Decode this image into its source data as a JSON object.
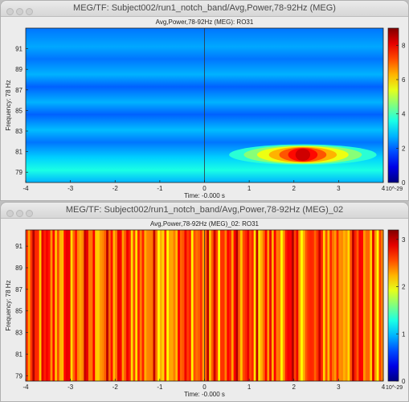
{
  "windows": [
    {
      "title": "MEG/TF: Subject002/run1_notch_band/Avg,Power,78-92Hz (MEG)"
    },
    {
      "title": "MEG/TF: Subject002/run1_notch_band/Avg,Power,78-92Hz (MEG)_02"
    }
  ],
  "chart_data": [
    {
      "type": "heatmap",
      "title": "Avg,Power,78-92Hz (MEG): RO31",
      "xlabel": "Time: -0.000 s",
      "ylabel": "Frequency: 78 Hz",
      "xlim": [
        -4,
        4
      ],
      "ylim": [
        78,
        93
      ],
      "xticks": [
        "-4",
        "-3",
        "-2",
        "-1",
        "0",
        "1",
        "2",
        "3",
        "4"
      ],
      "yticks": [
        "79",
        "81",
        "83",
        "85",
        "87",
        "89",
        "91"
      ],
      "colorbar": {
        "min": 0,
        "max": 9,
        "ticks": [
          "0",
          "2",
          "4",
          "6",
          "8"
        ],
        "exponent": "10^-29",
        "colormap": "jet"
      },
      "cursor_time": 0,
      "background_level": 0.3,
      "hotspot": {
        "time_center": 2.2,
        "freq_center": 80.7,
        "peak_value": 8.3,
        "time_span": [
          0.6,
          3.9
        ],
        "freq_span": [
          79.7,
          81.7
        ]
      }
    },
    {
      "type": "heatmap",
      "title": "Avg,Power,78-92Hz (MEG)_02: RO31",
      "xlabel": "Time: -0.000 s",
      "ylabel": "Frequency: 78 Hz",
      "xlim": [
        -4,
        4
      ],
      "ylim": [
        78.5,
        92.5
      ],
      "xticks": [
        "-4",
        "-3",
        "-2",
        "-1",
        "0",
        "1",
        "2",
        "3",
        "4"
      ],
      "yticks": [
        "79",
        "81",
        "83",
        "85",
        "87",
        "89",
        "91"
      ],
      "colorbar": {
        "min": 0,
        "max": 3.2,
        "ticks": [
          "0",
          "1",
          "2",
          "3"
        ],
        "exponent": "10^-29",
        "colormap": "jet"
      },
      "cursor_time": 0,
      "value_range": [
        2.0,
        3.0
      ],
      "columns": 160,
      "pattern": "vertical stripes, constant across frequency"
    }
  ]
}
